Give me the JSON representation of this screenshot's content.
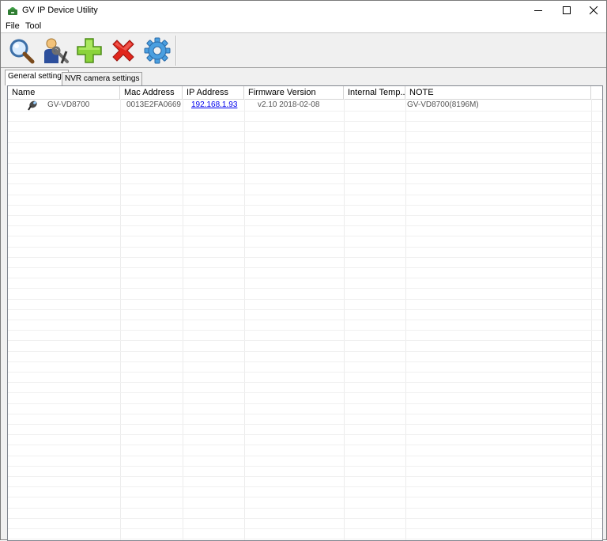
{
  "window": {
    "title": "GV IP Device Utility"
  },
  "menu": {
    "items": [
      "File",
      "Tool"
    ]
  },
  "toolbar": {
    "buttons": [
      {
        "icon": "search-icon"
      },
      {
        "icon": "user-tools-icon"
      },
      {
        "icon": "add-icon"
      },
      {
        "icon": "delete-icon"
      },
      {
        "icon": "gear-icon"
      }
    ]
  },
  "tabs": [
    {
      "label": "General settings",
      "active": true
    },
    {
      "label": "NVR camera settings",
      "active": false
    }
  ],
  "table": {
    "columns": [
      "Name",
      "Mac Address",
      "IP Address",
      "Firmware Version",
      "Internal Temp...",
      "NOTE"
    ],
    "rows": [
      {
        "name": "GV-VD8700",
        "mac": "0013E2FA0669",
        "ip": "192.168.1.93",
        "firmware": "v2.10  2018-02-08",
        "temp": "",
        "note": "GV-VD8700(8196M)"
      }
    ]
  },
  "colors": {
    "link": "#0000ee",
    "titlebar": "#ffffff",
    "chrome": "#f0f0f0"
  }
}
